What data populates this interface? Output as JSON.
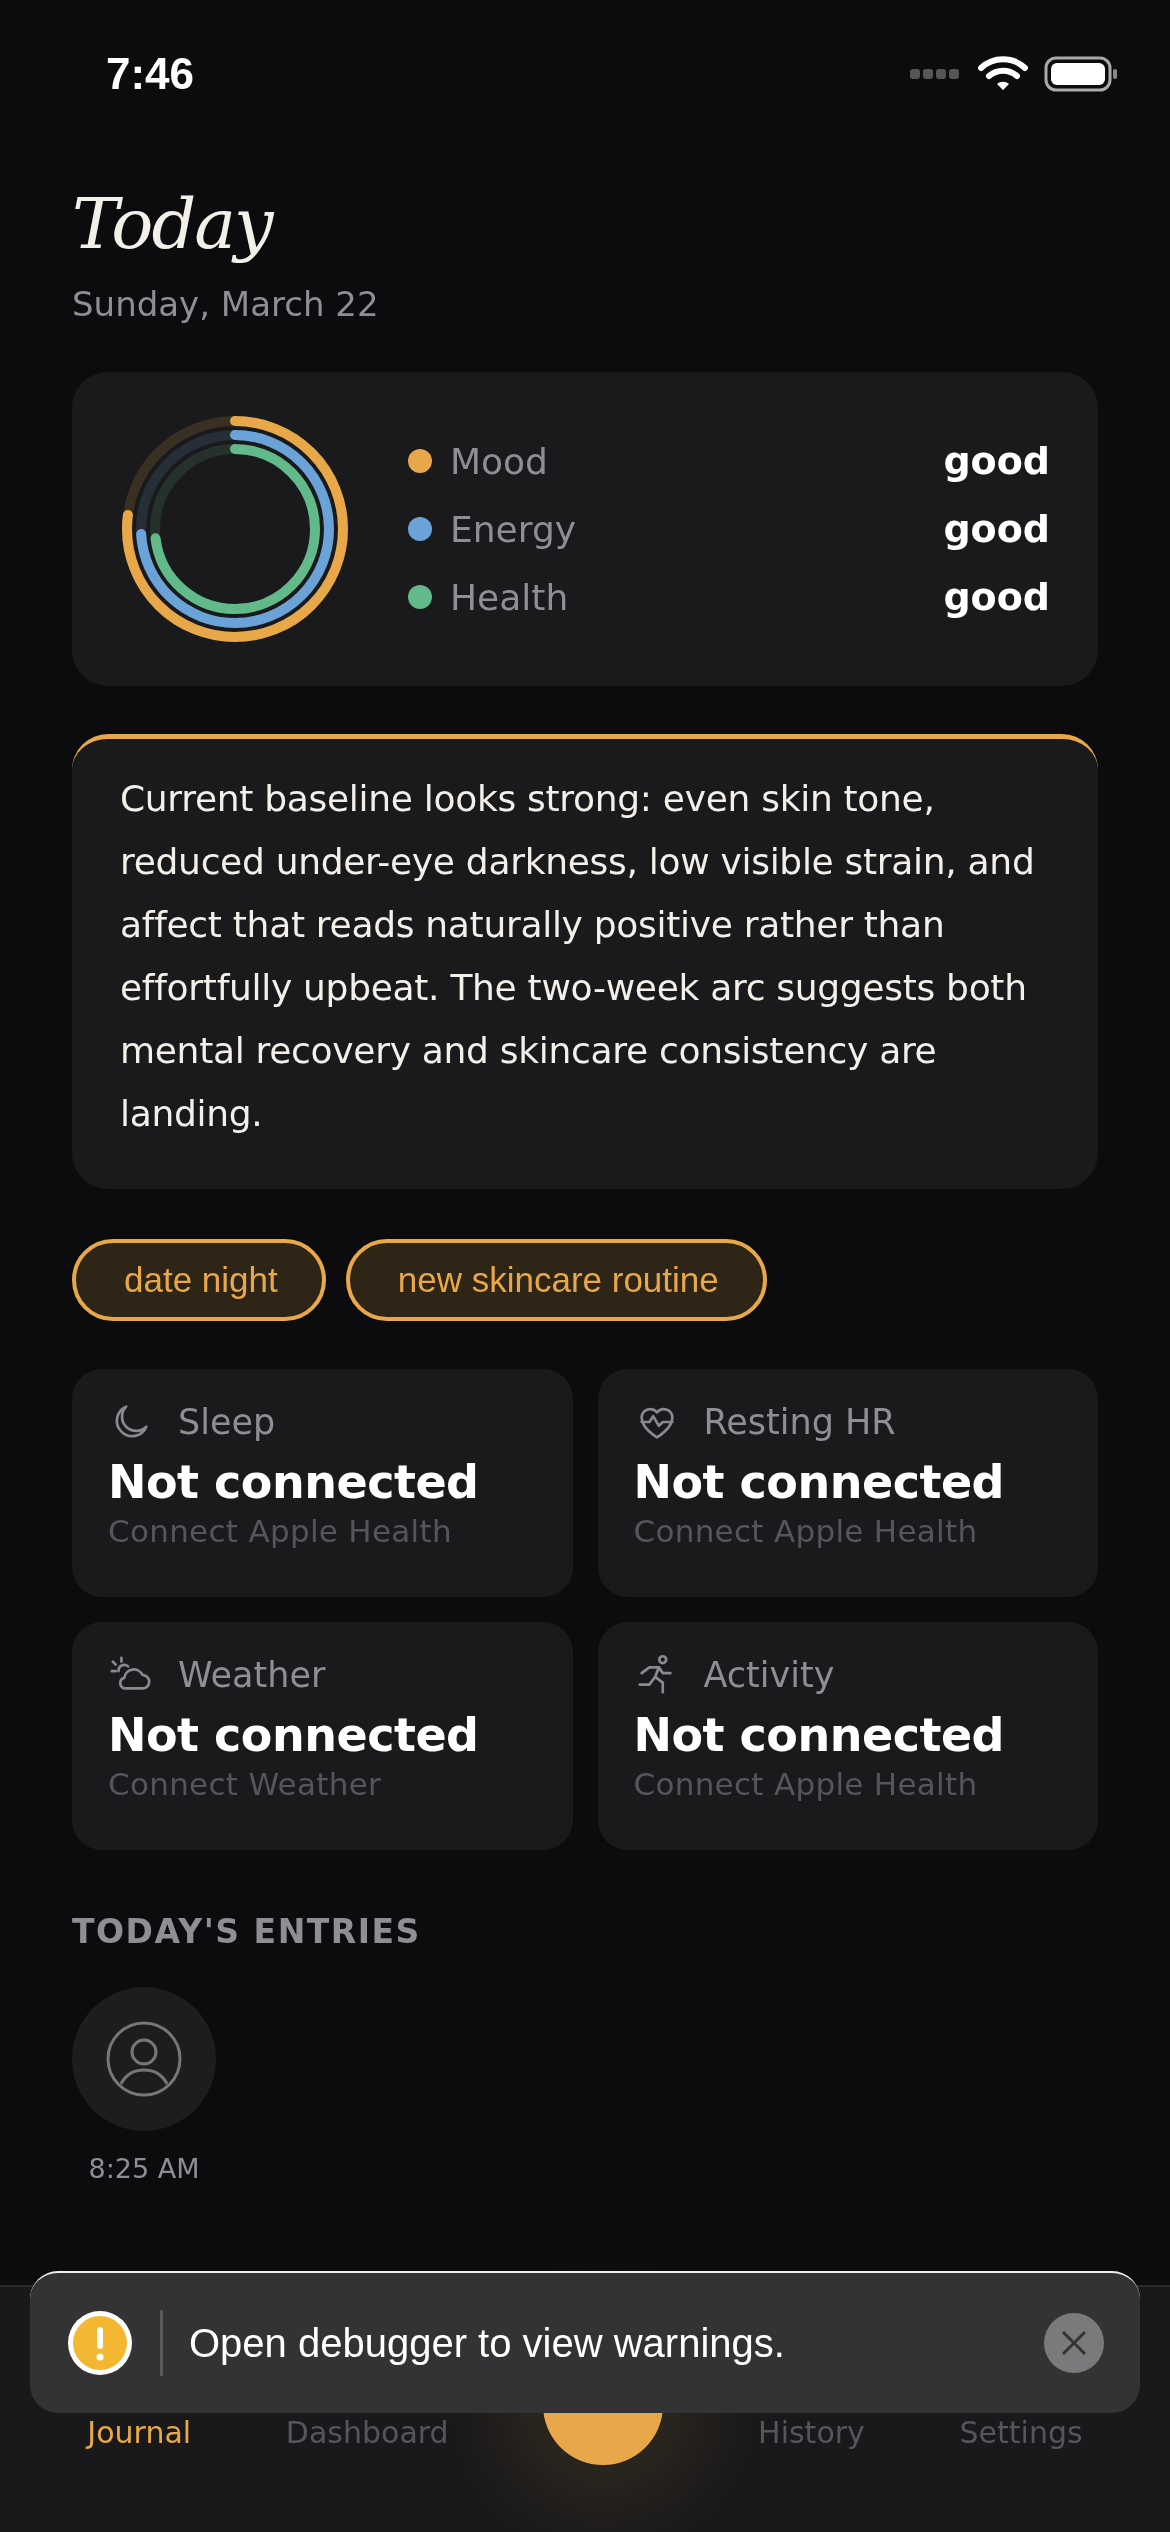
{
  "status_bar": {
    "time": "7:46"
  },
  "header": {
    "title": "Today",
    "date": "Sunday, March 22"
  },
  "metrics": [
    {
      "name": "Mood",
      "value": "good",
      "color": "#e8a84a",
      "level": 0.77
    },
    {
      "name": "Energy",
      "value": "good",
      "color": "#6ba3d8",
      "level": 0.74
    },
    {
      "name": "Health",
      "value": "good",
      "color": "#62b98a",
      "level": 0.73
    }
  ],
  "insight": {
    "text": "Current baseline looks strong: even skin tone, reduced under-eye darkness, low visible strain, and affect that reads naturally positive rather than effortfully upbeat. The two-week arc suggests both mental recovery and skincare consistency are landing."
  },
  "tags": [
    "date night",
    "new skincare routine"
  ],
  "stats": [
    {
      "kind": "sleep",
      "label": "Sleep",
      "value": "Not connected",
      "hint": "Connect Apple Health"
    },
    {
      "kind": "heart",
      "label": "Resting HR",
      "value": "Not connected",
      "hint": "Connect Apple Health"
    },
    {
      "kind": "weather",
      "label": "Weather",
      "value": "Not connected",
      "hint": "Connect Weather"
    },
    {
      "kind": "activity",
      "label": "Activity",
      "value": "Not connected",
      "hint": "Connect Apple Health"
    }
  ],
  "entries": {
    "heading": "TODAY'S ENTRIES",
    "items": [
      {
        "time": "8:25 AM"
      }
    ]
  },
  "tab_bar": [
    {
      "label": "Journal",
      "selected": true
    },
    {
      "label": "Dashboard",
      "selected": false
    },
    {
      "kind": "add"
    },
    {
      "label": "History",
      "selected": false
    },
    {
      "label": "Settings",
      "selected": false
    }
  ],
  "toast": {
    "message": "Open debugger to view warnings."
  }
}
